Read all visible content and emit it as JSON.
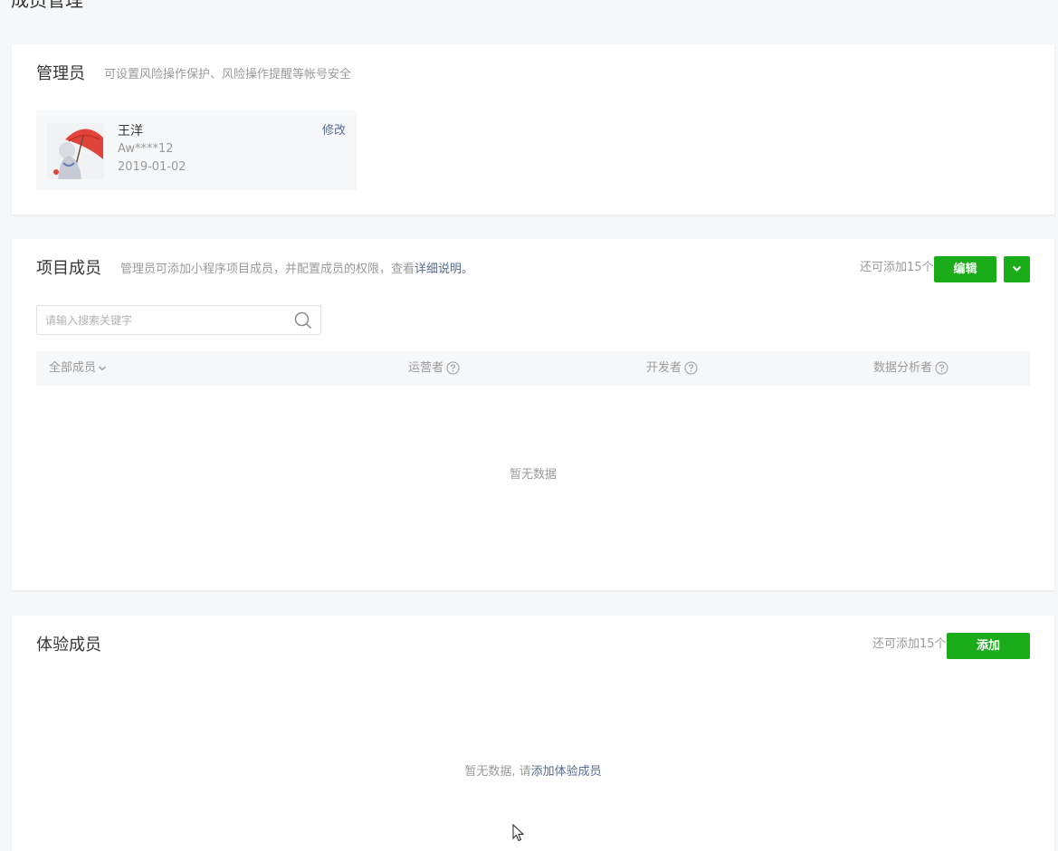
{
  "page": {
    "title": "成员管理"
  },
  "admin_section": {
    "title": "管理员",
    "description": "可设置风险操作保护、风险操作提醒等帐号安全",
    "admin": {
      "name": "王洋",
      "account": "Aw****12",
      "date": "2019-01-02",
      "edit_label": "修改"
    }
  },
  "project_section": {
    "title": "项目成员",
    "description": "管理员可添加小程序项目成员，并配置成员的权限，查看",
    "description_link": "详细说明",
    "description_end": "。",
    "remain_text": "还可添加15个",
    "edit_button": "编辑",
    "search": {
      "placeholder": "请输入搜索关键字",
      "value": ""
    },
    "columns": {
      "all": "全部成员",
      "operator": "运营者",
      "developer": "开发者",
      "analyst": "数据分析者"
    },
    "empty_text": "暂无数据"
  },
  "trial_section": {
    "title": "体验成员",
    "remain_text": "还可添加15个",
    "add_button": "添加",
    "empty_prefix": "暂无数据, 请",
    "empty_link": "添加体验成员"
  },
  "colors": {
    "primary_green": "#1aad19",
    "link_blue": "#576b95",
    "muted_text": "#9a9a9a",
    "background": "#f6f7f9"
  },
  "icons": {
    "search": "search-icon",
    "help": "question-circle-icon",
    "dropdown": "chevron-down-icon"
  }
}
